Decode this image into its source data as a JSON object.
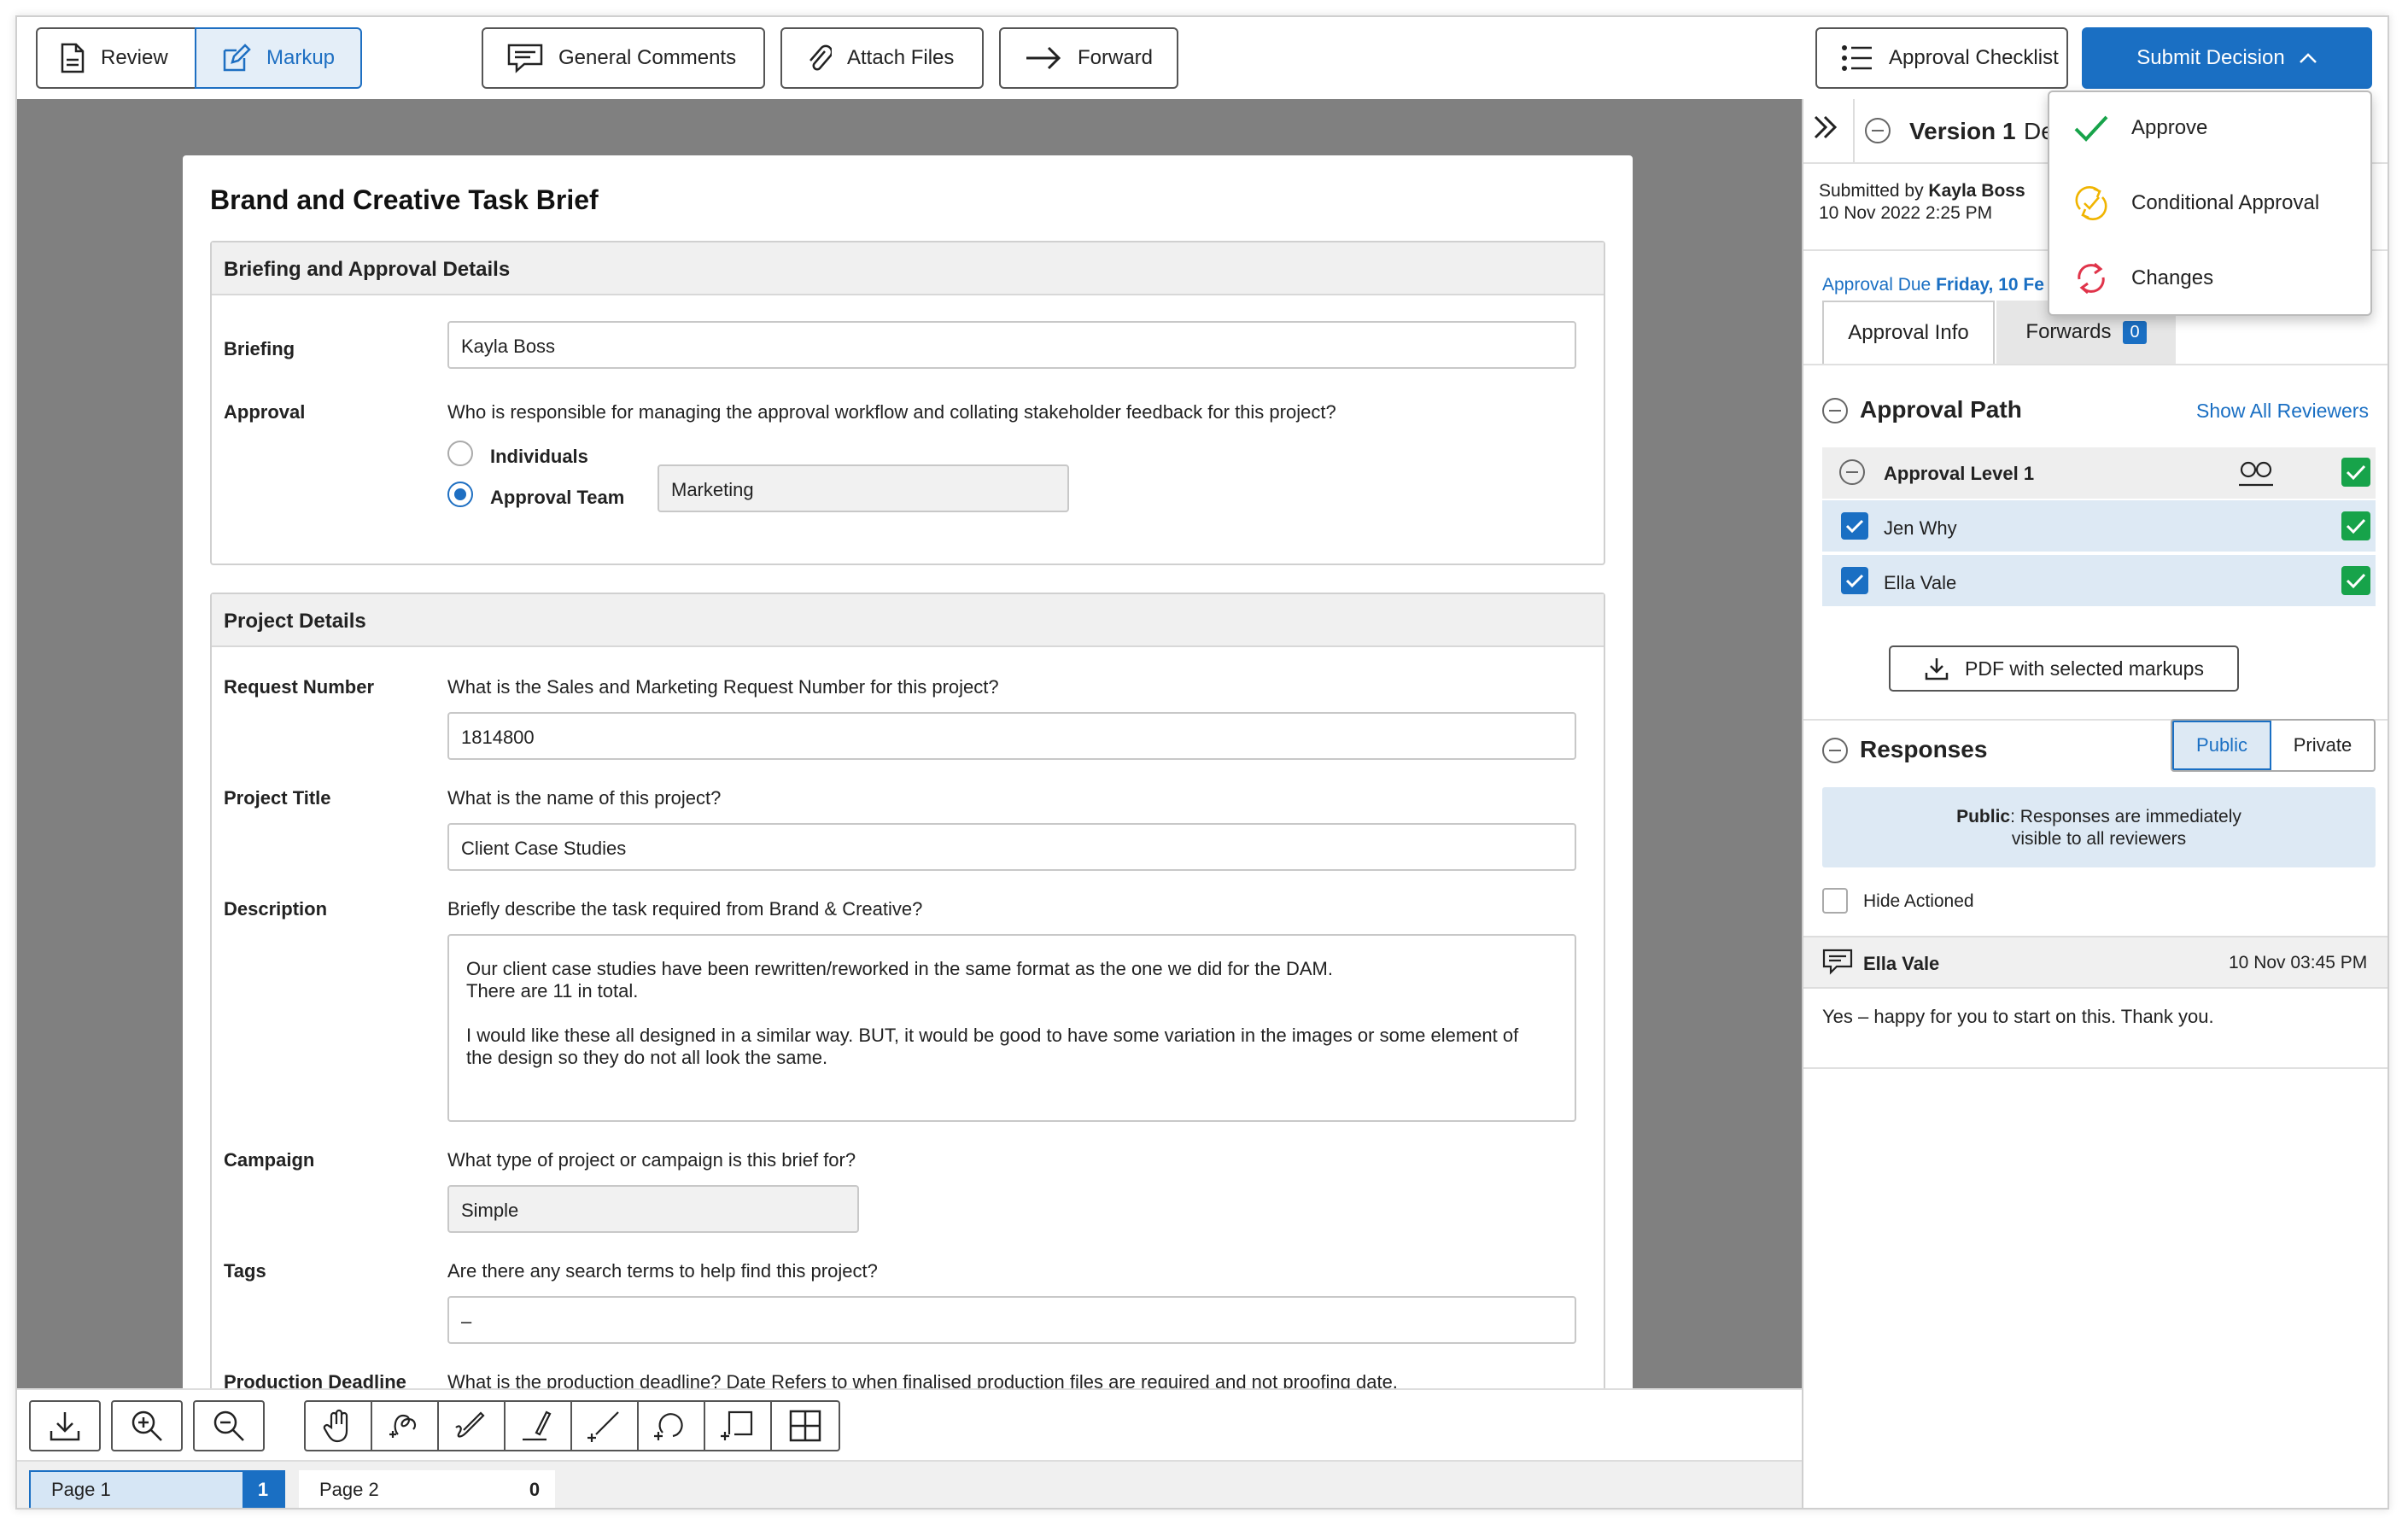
{
  "toolbar": {
    "review": "Review",
    "markup": "Markup",
    "general_comments": "General Comments",
    "attach_files": "Attach Files",
    "forward": "Forward",
    "approval_checklist": "Approval Checklist",
    "submit_decision": "Submit Decision"
  },
  "decision_menu": {
    "approve": "Approve",
    "conditional": "Conditional Approval",
    "changes": "Changes"
  },
  "document": {
    "title": "Brand and Creative Task Brief",
    "briefing_section": {
      "title": "Briefing and Approval Details",
      "briefing_label": "Briefing",
      "briefing_value": "Kayla Boss",
      "approval_label": "Approval",
      "approval_question": "Who is responsible for managing the approval workflow and collating stakeholder feedback for this project?",
      "option_individuals": "Individuals",
      "option_team": "Approval Team",
      "team_value": "Marketing"
    },
    "project_section": {
      "title": "Project Details",
      "request_label": "Request Number",
      "request_question": "What is the Sales and Marketing Request Number for this project?",
      "request_value": "1814800",
      "title_label": "Project Title",
      "title_question": "What is the name of this project?",
      "title_value": "Client Case Studies",
      "desc_label": "Description",
      "desc_question": "Briefly describe the task required from Brand & Creative?",
      "desc_line1": "Our client case studies have been rewritten/reworked in the same format as the one we did for the DAM.",
      "desc_line2": "There are 11 in total.",
      "desc_line3": "I would like these all designed in a similar way. BUT, it would be good to have some variation in the images or some element of",
      "desc_line4": "the design so they do not all look the same.",
      "campaign_label": "Campaign",
      "campaign_question": "What type of project or campaign is this brief for?",
      "campaign_value": "Simple",
      "tags_label": "Tags",
      "tags_question": "Are there any search terms to help find this project?",
      "tags_value": "–",
      "deadline_label": "Production Deadline",
      "deadline_question": "What is the production deadline? Date Refers to when finalised production files are required and not proofing date."
    }
  },
  "pages": [
    {
      "label": "Page 1",
      "count": "1"
    },
    {
      "label": "Page 2",
      "count": "0"
    }
  ],
  "panel": {
    "version_title": "Version 1",
    "version_cut": "De",
    "submitted_prefix": "Submitted by",
    "submitted_by": "Kayla Boss",
    "submitted_date": "10 Nov 2022 2:25 PM",
    "due_prefix": "Approval Due",
    "due_date": "Friday, 10 Fe",
    "tab_info": "Approval Info",
    "tab_forwards": "Forwards",
    "forwards_count": "0",
    "approval_path": "Approval Path",
    "show_all": "Show All Reviewers",
    "level_1": "Approval Level 1",
    "reviewers": [
      "Jen Why",
      "Ella Vale"
    ],
    "pdf_button": "PDF with selected markups",
    "responses": "Responses",
    "public": "Public",
    "private": "Private",
    "info_bold": "Public",
    "info_line1": ": Responses are immediately",
    "info_line2": "visible to all reviewers",
    "hide_actioned": "Hide Actioned",
    "comment_author": "Ella Vale",
    "comment_time": "10 Nov 03:45 PM",
    "comment_text": "Yes – happy for you to start on this. Thank you."
  },
  "colors": {
    "accent": "#1a6fc3",
    "success": "#17a34a",
    "warning": "#f0b400",
    "danger": "#e0344a"
  }
}
